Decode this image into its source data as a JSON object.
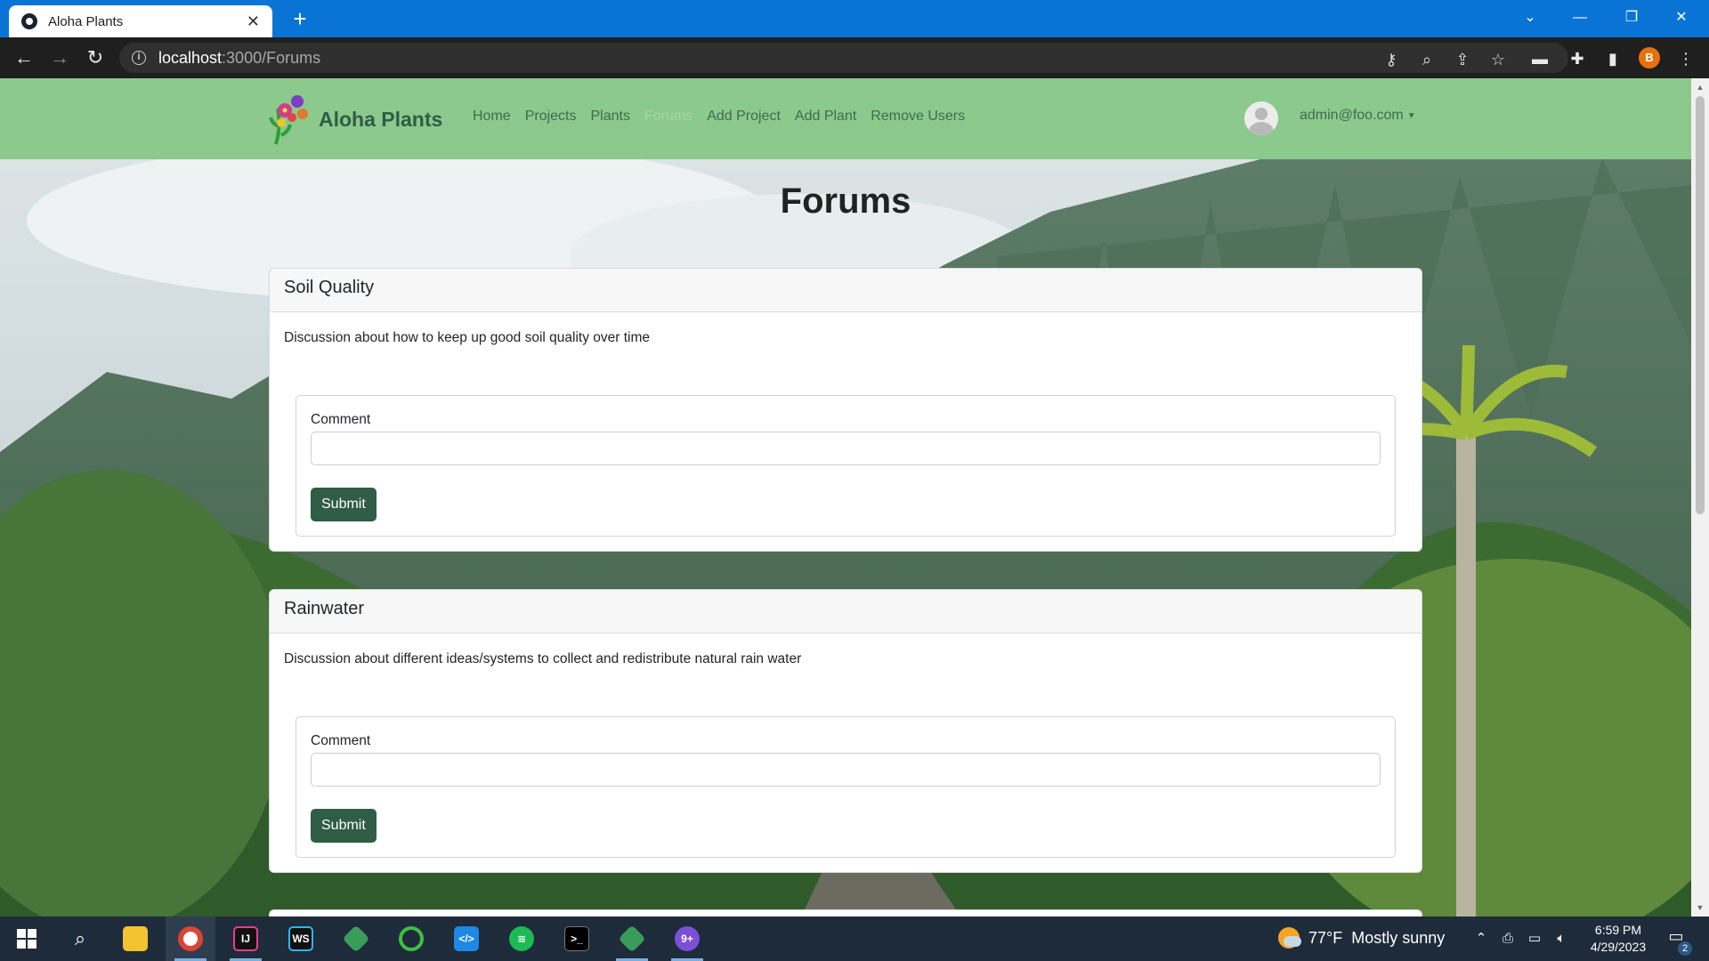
{
  "browser": {
    "tab_title": "Aloha Plants",
    "tab_close": "✕",
    "new_tab": "+",
    "url_host": "localhost",
    "url_path": ":3000/Forums",
    "profile_initial": "B"
  },
  "site": {
    "brand": "Aloha Plants",
    "nav": [
      {
        "label": "Home",
        "active": false
      },
      {
        "label": "Projects",
        "active": false
      },
      {
        "label": "Plants",
        "active": false
      },
      {
        "label": "Forums",
        "active": true
      },
      {
        "label": "Add Project",
        "active": false
      },
      {
        "label": "Add Plant",
        "active": false
      },
      {
        "label": "Remove Users",
        "active": false
      }
    ],
    "user_email": "admin@foo.com",
    "colors": {
      "navbar": "#8cc98c",
      "brand_text": "#2f5d46",
      "button": "#2f5d46"
    }
  },
  "page": {
    "title": "Forums",
    "forums": [
      {
        "title": "Soil Quality",
        "description": "Discussion about how to keep up good soil quality over time",
        "comment_label": "Comment",
        "comment_value": "",
        "submit_label": "Submit"
      },
      {
        "title": "Rainwater",
        "description": "Discussion about different ideas/systems to collect and redistribute natural rain water",
        "comment_label": "Comment",
        "comment_value": "",
        "submit_label": "Submit"
      }
    ]
  },
  "taskbar": {
    "weather": {
      "temp": "77°F",
      "condition": "Mostly sunny"
    },
    "time": "6:59 PM",
    "date": "4/29/2023",
    "notification_count": "2"
  }
}
